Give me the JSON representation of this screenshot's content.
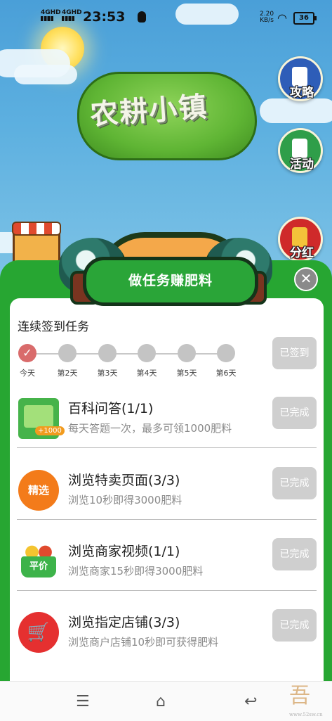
{
  "status_bar": {
    "net1": "4GHD",
    "net2": "4GHD",
    "time": "23:53",
    "speed_value": "2.20",
    "speed_unit": "KB/s",
    "battery": "36"
  },
  "game": {
    "logo": "农耕小镇",
    "side_buttons": [
      {
        "label": "攻略",
        "icon": "guide-icon"
      },
      {
        "label": "活动",
        "icon": "activity-icon"
      },
      {
        "label": "分红",
        "icon": "red-packet-icon"
      }
    ]
  },
  "modal": {
    "title": "做任务赚肥料",
    "close_symbol": "✕",
    "checkin": {
      "title": "连续签到任务",
      "days": [
        {
          "label": "今天",
          "done": true
        },
        {
          "label": "第2天",
          "done": false
        },
        {
          "label": "第3天",
          "done": false
        },
        {
          "label": "第4天",
          "done": false
        },
        {
          "label": "第5天",
          "done": false
        },
        {
          "label": "第6天",
          "done": false
        }
      ],
      "button": "已签到"
    },
    "tasks": [
      {
        "title": "百科问答(1/1)",
        "desc": "每天答题一次，最多可领1000肥料",
        "button": "已完成",
        "icon": "book-icon",
        "badge": "+1000"
      },
      {
        "title": "浏览特卖页面(3/3)",
        "desc": "浏览10秒即得3000肥料",
        "button": "已完成",
        "icon": "select-icon",
        "icon_text": "精选"
      },
      {
        "title": "浏览商家视频(1/1)",
        "desc": "浏览商家15秒即得3000肥料",
        "button": "已完成",
        "icon": "fruit-basket-icon",
        "icon_text": "平价"
      },
      {
        "title": "浏览指定店铺(3/3)",
        "desc": "浏览商户店铺10秒即可获得肥料",
        "button": "已完成",
        "icon": "shopping-cart-icon"
      }
    ]
  },
  "colors": {
    "panel_green": "#27a632",
    "done_grey": "#cfcfcf",
    "checked_red": "#d96b6b"
  },
  "watermark": {
    "glyph": "吾",
    "site": "www.52sw.cn"
  }
}
